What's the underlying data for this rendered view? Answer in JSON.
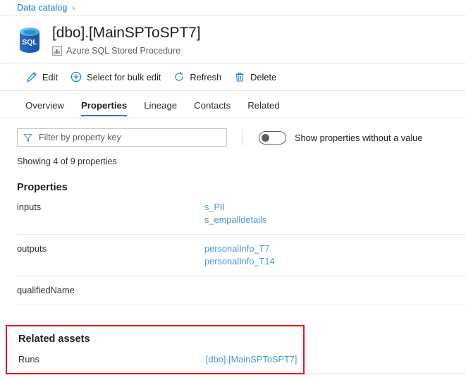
{
  "breadcrumb": {
    "items": [
      {
        "label": "Data catalog",
        "separator": "›"
      }
    ]
  },
  "header": {
    "title": "[dbo].[MainSPToSPT7]",
    "subtitle": "Azure SQL Stored Procedure",
    "asset_icon": "sql-database-icon",
    "type_icon": "asset-type-icon",
    "icon_text": "SQL"
  },
  "commands": [
    {
      "label": "Edit",
      "icon": "pencil-icon"
    },
    {
      "label": "Select for bulk edit",
      "icon": "circle-plus-icon"
    },
    {
      "label": "Refresh",
      "icon": "refresh-icon"
    },
    {
      "label": "Delete",
      "icon": "trash-icon"
    }
  ],
  "tabs": [
    {
      "label": "Overview",
      "active": false
    },
    {
      "label": "Properties",
      "active": true
    },
    {
      "label": "Lineage",
      "active": false
    },
    {
      "label": "Contacts",
      "active": false
    },
    {
      "label": "Related",
      "active": false
    }
  ],
  "filter": {
    "placeholder": "Filter by property key",
    "value": "",
    "icon": "funnel-icon"
  },
  "toggle": {
    "label": "Show properties without a value",
    "state": "off"
  },
  "status": {
    "showing": "Showing 4 of 9 properties"
  },
  "properties": {
    "title": "Properties",
    "rows": [
      {
        "key": "inputs",
        "values": [
          "s_PII",
          "s_empalldetails"
        ]
      },
      {
        "key": "outputs",
        "values": [
          "personalInfo_T7",
          "personalInfo_T14"
        ]
      },
      {
        "key": "qualifiedName",
        "values": []
      }
    ]
  },
  "related_assets": {
    "title": "Related assets",
    "rows": [
      {
        "key": "Runs",
        "value": "[dbo].[MainSPToSPT7]"
      }
    ],
    "highlight_color": "#e81123"
  },
  "colors": {
    "link": "#0078d4",
    "value_link": "#4a95e0",
    "accent": "#0078d4",
    "text": "#323130",
    "divider": "#edebe9",
    "highlight": "#e81123"
  }
}
